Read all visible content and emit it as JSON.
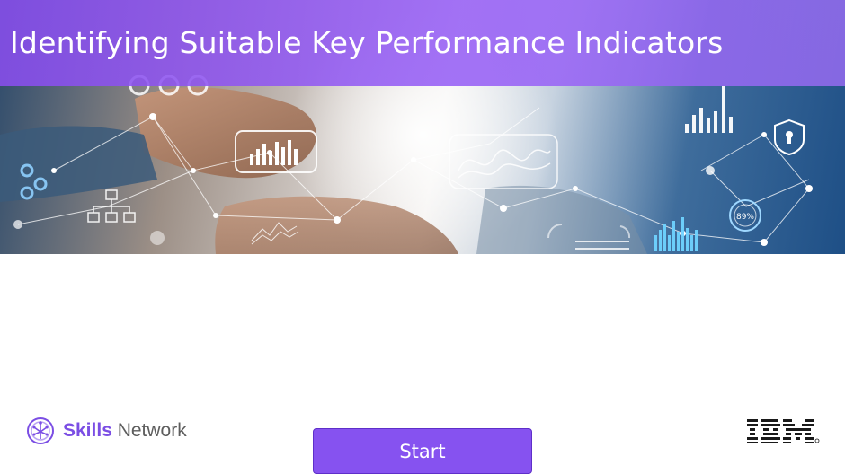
{
  "hero": {
    "title": "Identifying Suitable Key Performance Indicators",
    "image_label": "89%"
  },
  "footer": {
    "brand": {
      "strong_text": "Skills",
      "regular_text": " Network",
      "icon": "skills-network-logo"
    },
    "start_label": "Start",
    "partner_logo": "IBM"
  },
  "colors": {
    "accent": "#8652f0",
    "title_band": "#8a4eee",
    "brand_purple": "#7b4ee4"
  }
}
